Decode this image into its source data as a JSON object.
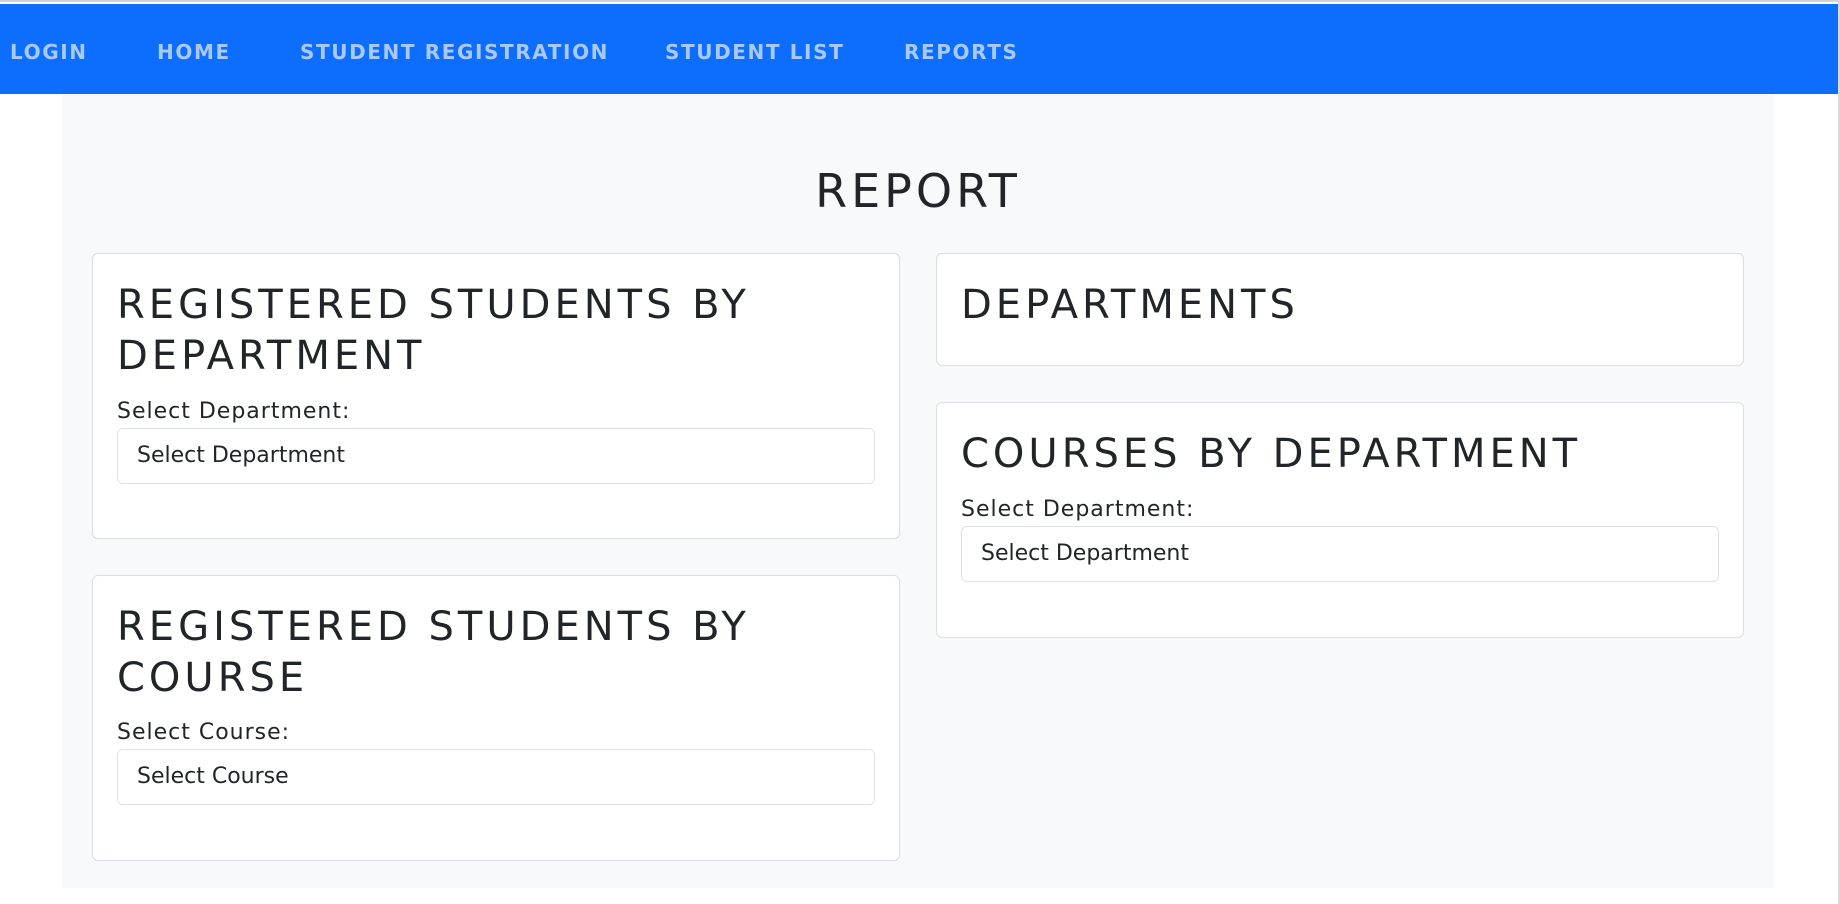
{
  "navbar": {
    "items": [
      {
        "label": "LOGIN"
      },
      {
        "label": "HOME"
      },
      {
        "label": "STUDENT REGISTRATION"
      },
      {
        "label": "STUDENT LIST"
      },
      {
        "label": "REPORTS"
      }
    ]
  },
  "page": {
    "title": "REPORT"
  },
  "cards": {
    "students_by_department": {
      "title": "REGISTERED STUDENTS BY DEPARTMENT",
      "label": "Select Department:",
      "select_value": "Select Department"
    },
    "departments": {
      "title": "DEPARTMENTS"
    },
    "courses_by_department": {
      "title": "COURSES BY DEPARTMENT",
      "label": "Select Department:",
      "select_value": "Select Department"
    },
    "students_by_course": {
      "title": "REGISTERED STUDENTS BY COURSE",
      "label": "Select Course:",
      "select_value": "Select Course"
    }
  },
  "colors": {
    "navbar": "#0d6efd",
    "nav_text": "#a9c9f7",
    "page_bg": "#f8f9fa",
    "card_bg": "#ffffff"
  }
}
